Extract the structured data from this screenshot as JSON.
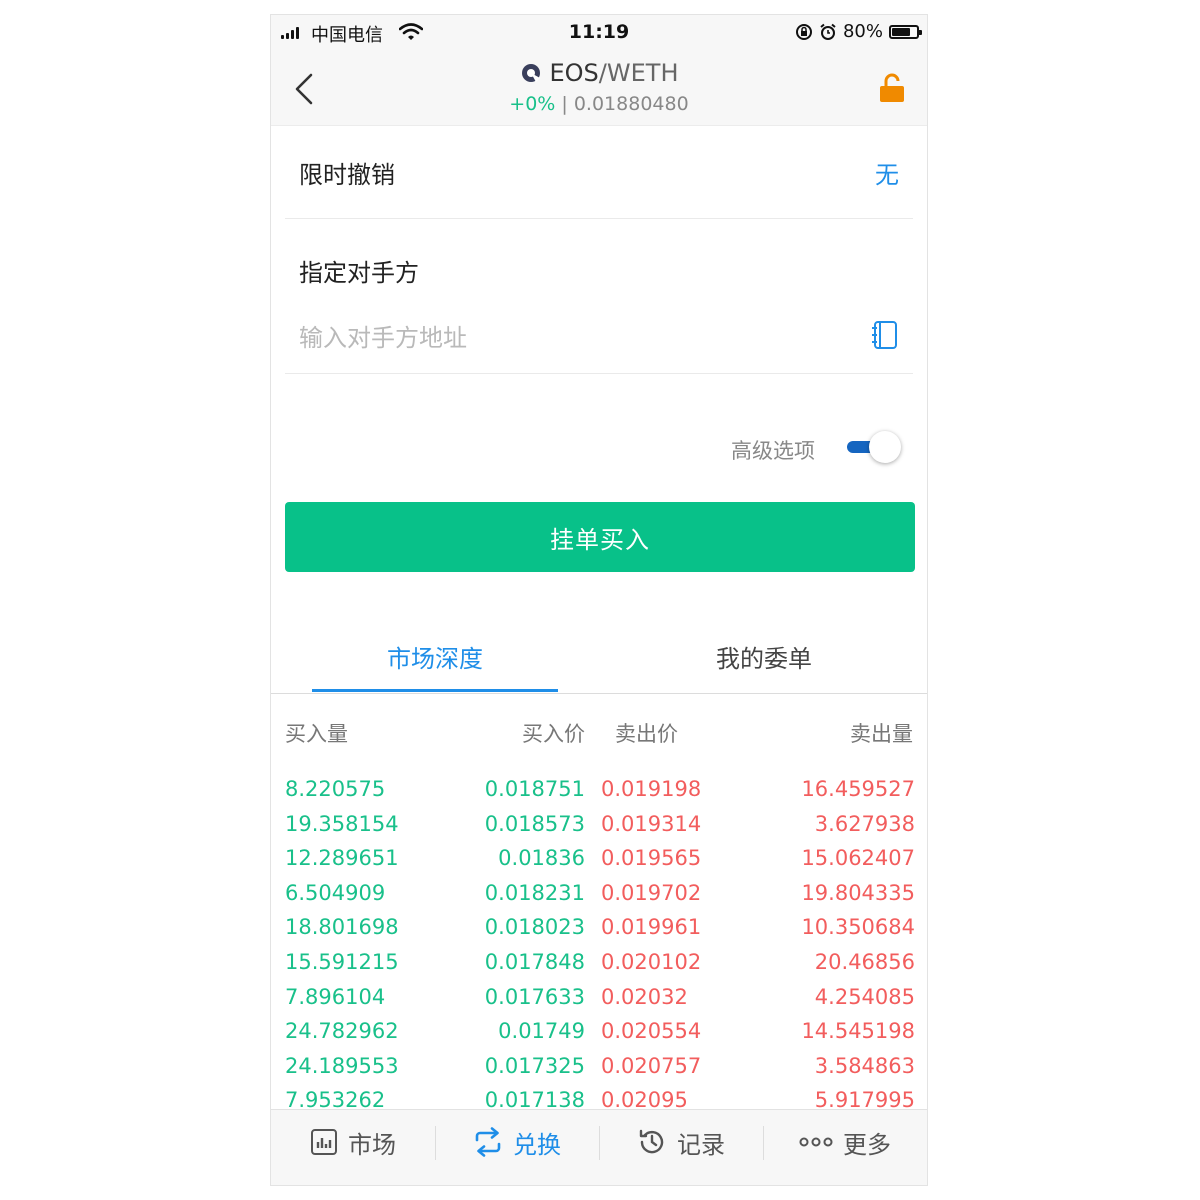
{
  "status_bar": {
    "carrier": "中国电信",
    "time": "11:19",
    "battery_text": "80%",
    "battery_level": 0.8
  },
  "nav": {
    "base": "EOS",
    "quote": "/WETH",
    "change": "+0%",
    "separator": " | ",
    "price": "0.01880480",
    "back_icon": "chevron-left-icon",
    "lock_icon": "unlock-icon",
    "lock_color": "#f08a00"
  },
  "form": {
    "cancel_label": "限时撤销",
    "cancel_value": "无",
    "counterparty_label": "指定对手方",
    "counterparty_placeholder": "输入对手方地址",
    "advanced_label": "高级选项",
    "advanced_on": true,
    "submit_label": "挂单买入"
  },
  "tabs": [
    {
      "label": "市场深度",
      "active": true
    },
    {
      "label": "我的委单",
      "active": false
    }
  ],
  "depth": {
    "headers": [
      "买入量",
      "买入价",
      "卖出价",
      "卖出量"
    ],
    "rows": [
      [
        "8.220575",
        "0.018751",
        "0.019198",
        "16.459527"
      ],
      [
        "19.358154",
        "0.018573",
        "0.019314",
        "3.627938"
      ],
      [
        "12.289651",
        "0.01836",
        "0.019565",
        "15.062407"
      ],
      [
        "6.504909",
        "0.018231",
        "0.019702",
        "19.804335"
      ],
      [
        "18.801698",
        "0.018023",
        "0.019961",
        "10.350684"
      ],
      [
        "15.591215",
        "0.017848",
        "0.020102",
        "20.46856"
      ],
      [
        "7.896104",
        "0.017633",
        "0.02032",
        "4.254085"
      ],
      [
        "24.782962",
        "0.01749",
        "0.020554",
        "14.545198"
      ],
      [
        "24.189553",
        "0.017325",
        "0.020757",
        "3.584863"
      ],
      [
        "7.953262",
        "0.017138",
        "0.02095",
        "5.917995"
      ]
    ],
    "buy_color": "#19c08a",
    "sell_color": "#f25d5d"
  },
  "tabbar": [
    {
      "label": "市场",
      "icon": "bar-chart-icon",
      "active": false
    },
    {
      "label": "兑换",
      "icon": "swap-icon",
      "active": true
    },
    {
      "label": "记录",
      "icon": "clock-icon",
      "active": false
    },
    {
      "label": "更多",
      "icon": "more-dots-icon",
      "active": false
    }
  ],
  "colors": {
    "accent": "#1f8ee8",
    "primary_button": "#08c189",
    "toggle_track": "#1565c0"
  }
}
